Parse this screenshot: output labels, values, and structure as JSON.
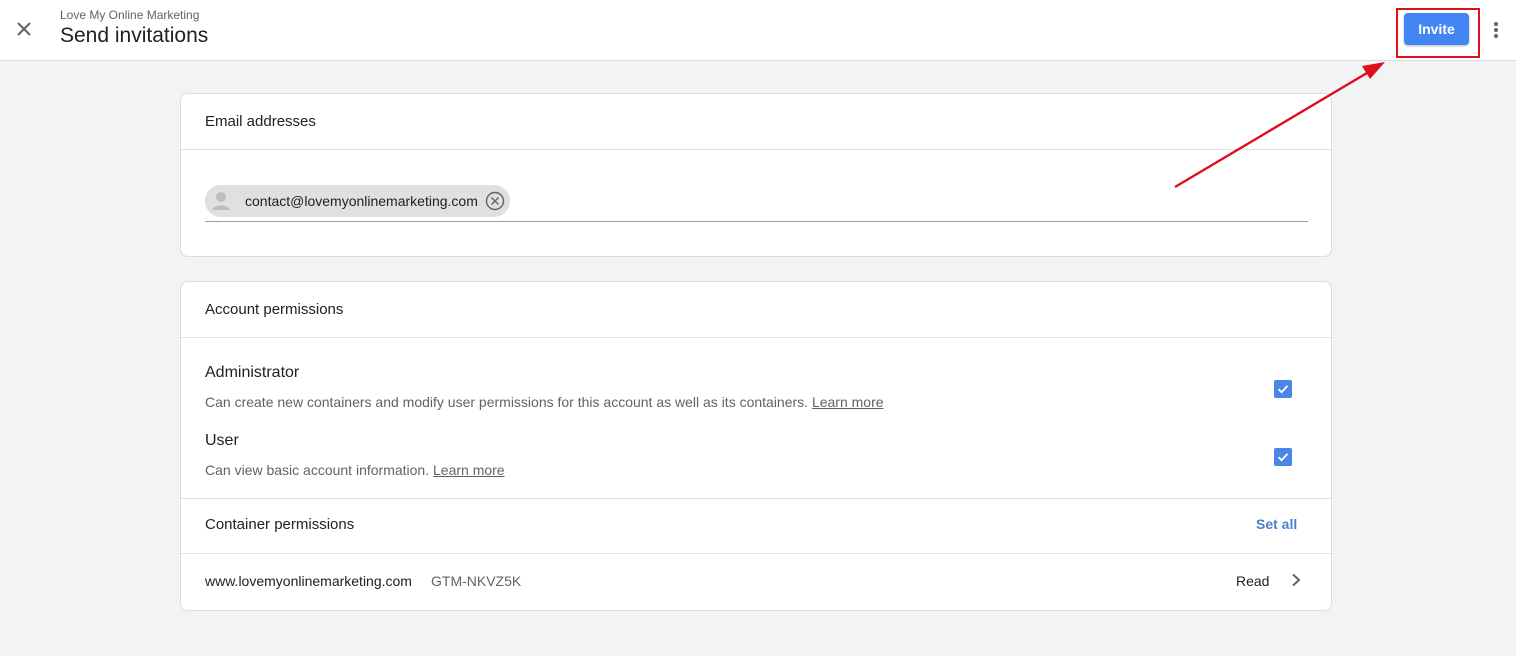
{
  "header": {
    "account_name": "Love My Online Marketing",
    "title": "Send invitations",
    "invite_label": "Invite"
  },
  "email_section": {
    "title": "Email addresses",
    "chips": [
      "contact@lovemyonlinemarketing.com"
    ]
  },
  "account_permissions": {
    "title": "Account permissions",
    "roles": [
      {
        "name": "Administrator",
        "description": "Can create new containers and modify user permissions for this account as well as its containers.",
        "learn_more": "Learn more",
        "checked": true
      },
      {
        "name": "User",
        "description": "Can view basic account information.",
        "learn_more": "Learn more",
        "checked": true
      }
    ]
  },
  "container_permissions": {
    "title": "Container permissions",
    "set_all_label": "Set all",
    "containers": [
      {
        "name": "www.lovemyonlinemarketing.com",
        "id": "GTM-NKVZ5K",
        "role": "Read"
      }
    ]
  },
  "icons": {
    "close": "close-icon",
    "more": "more-vert-icon",
    "avatar": "person-icon",
    "remove": "cancel-circle-icon",
    "checkbox": "check-icon",
    "chevron": "chevron-right-icon"
  },
  "colors": {
    "accent": "#4285f4",
    "checkbox": "#4a86e8",
    "annotation": "#e00d1b",
    "link": "#4a7fd0"
  }
}
